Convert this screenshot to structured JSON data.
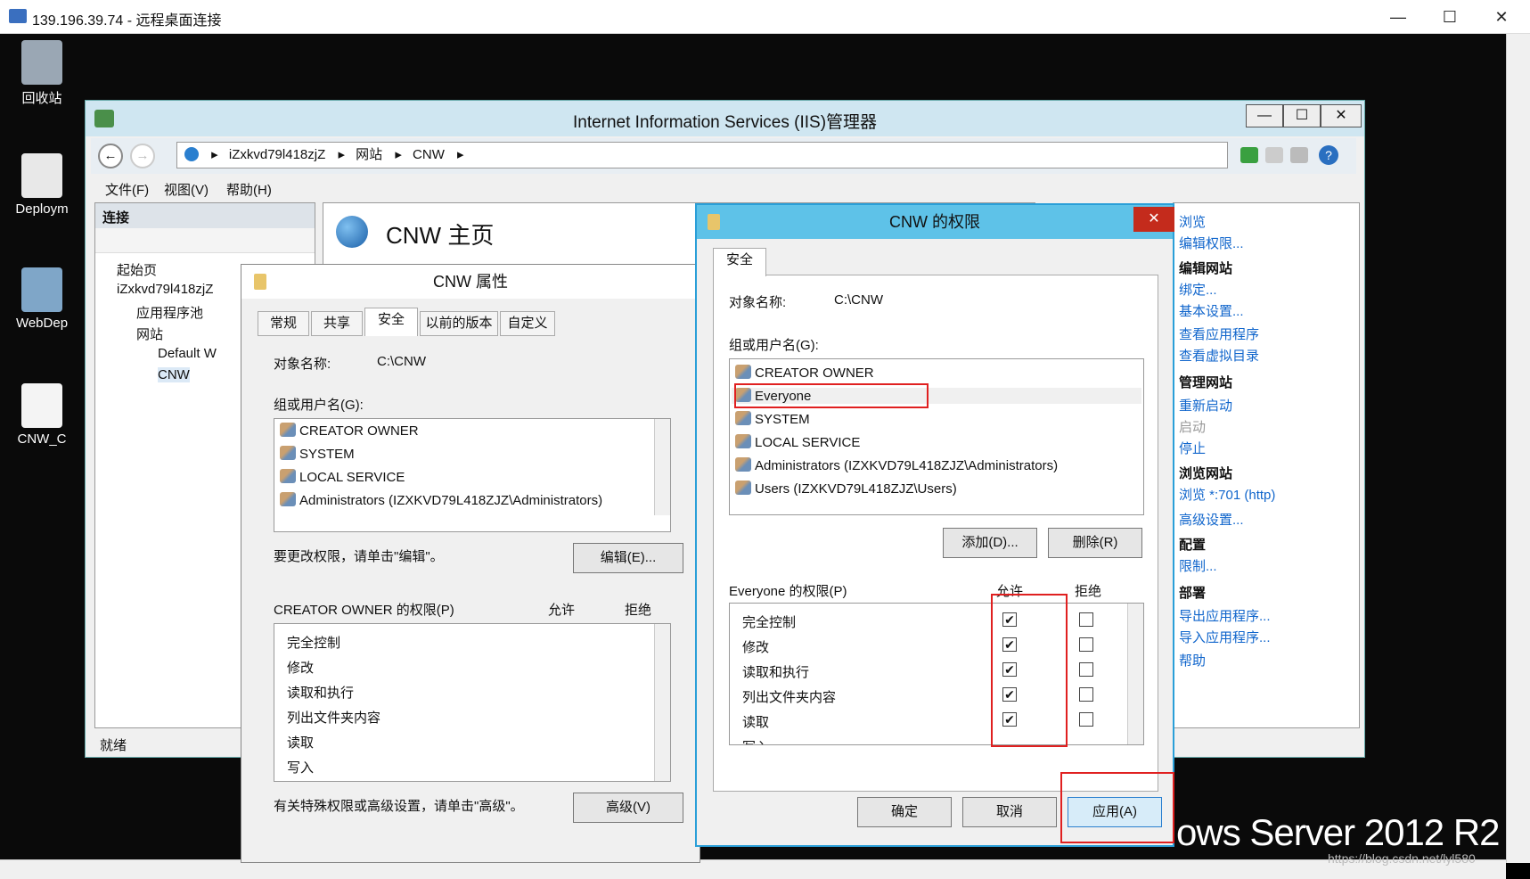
{
  "rdp": {
    "title": "139.196.39.74 - 远程桌面连接",
    "min": "—",
    "max": "☐",
    "close": "✕"
  },
  "desktop": {
    "icons": [
      "回收站",
      "Deploym",
      "WebDep",
      "CNW_C"
    ],
    "brand": "ows Server 2012 R2",
    "watermark": "https://blog.csdn.net/lyl580"
  },
  "iis": {
    "title": "Internet Information Services (IIS)管理器",
    "address": [
      "iZxkvd79l418zjZ",
      "网站",
      "CNW"
    ],
    "menu": [
      "文件(F)",
      "视图(V)",
      "帮助(H)"
    ],
    "connections": "连接",
    "tree": [
      "起始页",
      "iZxkvd79l418zjZ",
      "应用程序池",
      "网站",
      "Default W",
      "CNW"
    ],
    "status": "就绪",
    "home_title": "CNW 主页",
    "actions": [
      "浏览",
      "编辑权限...",
      "编辑网站",
      "绑定...",
      "基本设置...",
      "查看应用程序",
      "查看虚拟目录",
      "管理网站",
      "重新启动",
      "启动",
      "停止",
      "浏览网站",
      "浏览 *:701 (http)",
      "高级设置...",
      "配置",
      "限制...",
      "部署",
      "导出应用程序...",
      "导入应用程序...",
      "帮助"
    ]
  },
  "props": {
    "title": "CNW 属性",
    "tabs": [
      "常规",
      "共享",
      "安全",
      "以前的版本",
      "自定义"
    ],
    "object_label": "对象名称:",
    "object_value": "C:\\CNW",
    "group_label": "组或用户名(G):",
    "users": [
      "CREATOR OWNER",
      "SYSTEM",
      "LOCAL SERVICE",
      "Administrators (IZXKVD79L418ZJZ\\Administrators)"
    ],
    "edit_hint": "要更改权限，请单击\"编辑\"。",
    "edit_btn": "编辑(E)...",
    "perm_label": "CREATOR OWNER 的权限(P)",
    "allow": "允许",
    "deny": "拒绝",
    "perms": [
      "完全控制",
      "修改",
      "读取和执行",
      "列出文件夹内容",
      "读取",
      "写入"
    ],
    "adv_hint": "有关特殊权限或高级设置，请单击\"高级\"。",
    "adv_btn": "高级(V)"
  },
  "perm": {
    "title": "CNW 的权限",
    "close": "✕",
    "tab": "安全",
    "object_label": "对象名称:",
    "object_value": "C:\\CNW",
    "group_label": "组或用户名(G):",
    "users": [
      "CREATOR OWNER",
      "Everyone",
      "SYSTEM",
      "LOCAL SERVICE",
      "Administrators (IZXKVD79L418ZJZ\\Administrators)",
      "Users (IZXKVD79L418ZJZ\\Users)"
    ],
    "add_btn": "添加(D)...",
    "remove_btn": "删除(R)",
    "perm_label": "Everyone 的权限(P)",
    "allow": "允许",
    "deny": "拒绝",
    "perms": [
      "完全控制",
      "修改",
      "读取和执行",
      "列出文件夹内容",
      "读取",
      "写入"
    ],
    "ok": "确定",
    "cancel": "取消",
    "apply": "应用(A)",
    "check": "✔"
  }
}
